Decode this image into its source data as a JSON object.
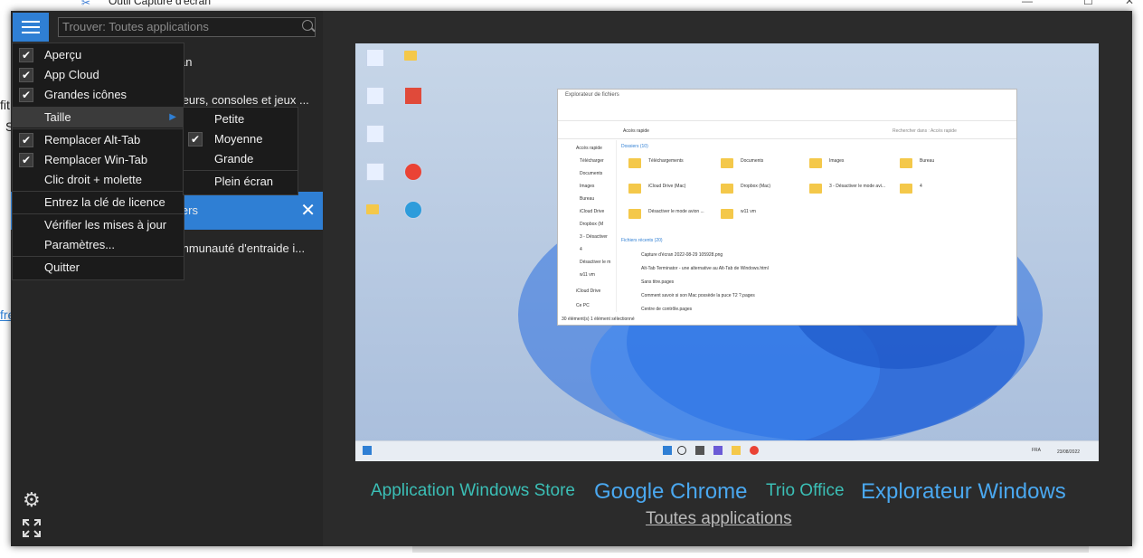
{
  "background_app": {
    "title": "Outil Capture d'écran",
    "left_fragments": [
      "fit",
      "S",
      "fre"
    ]
  },
  "search": {
    "placeholder": "Trouver: Toutes applications"
  },
  "app_list": [
    {
      "label": "an"
    },
    {
      "label": "teurs, consoles et jeux ..."
    },
    {
      "label": "iers"
    },
    {
      "label": "mmunauté d'entraide i..."
    }
  ],
  "menu": {
    "items": [
      {
        "label": "Aperçu",
        "checked": true
      },
      {
        "label": "App Cloud",
        "checked": true
      },
      {
        "label": "Grandes icônes",
        "checked": true
      },
      {
        "label": "Taille",
        "has_submenu": true
      },
      {
        "label": "Remplacer Alt-Tab",
        "checked": true
      },
      {
        "label": "Remplacer Win-Tab",
        "checked": true
      },
      {
        "label": "Clic droit + molette",
        "checked": false
      },
      {
        "label": "Entrez la clé de licence"
      },
      {
        "label": "Vérifier les mises à jour"
      },
      {
        "label": "Paramètres..."
      },
      {
        "label": "Quitter"
      }
    ],
    "size_submenu": [
      {
        "label": "Petite",
        "checked": false
      },
      {
        "label": "Moyenne",
        "checked": true
      },
      {
        "label": "Grande",
        "checked": false
      },
      {
        "label": "Plein écran",
        "checked": false
      }
    ]
  },
  "preview": {
    "explorer_title": "Explorateur de fichiers",
    "address": "Accès rapide",
    "search_placeholder": "Rechercher dans : Accès rapide",
    "folders_header": "Dossiers (10)",
    "recent_header": "Fichiers récents (20)",
    "status": "30 élément(s)   1 élément sélectionné",
    "sidebar": [
      "Accès rapide",
      "Télécharger",
      "Documents",
      "Images",
      "Bureau",
      "iCloud Drive",
      "Dropbox (M",
      "3 - Désactiver",
      "4",
      "Désactiver le m",
      "w11 vm",
      "iCloud Drive",
      "Ce PC"
    ],
    "folders": [
      "Téléchargements",
      "Documents",
      "Images",
      "Bureau",
      "iCloud Drive (Mac)",
      "Dropbox (Mac)",
      "3 - Désactiver le mode avi...",
      "4",
      "Désactiver le mode avion ...",
      "w11 vm"
    ],
    "recent_files": [
      "Capture d'écran 2022-08-29 105928.png",
      "Alt-Tab Terminator - une alternative au Alt-Tab de Windows.html",
      "Sans titre.pages",
      "Comment savoir si son Mac possède la puce T2 ?.pages",
      "Centre de contrôle.pages"
    ],
    "taskbar_time": "23/08/2022",
    "taskbar_lang": "FRA"
  },
  "app_links": {
    "store": "Application Windows Store",
    "chrome": "Google Chrome",
    "office": "Trio Office",
    "explorer": "Explorateur Windows",
    "all": "Toutes applications"
  },
  "colors": {
    "accent": "#2f7fd4",
    "teal_link": "#3bbfb6",
    "blue_link": "#4aa8f0",
    "panel_bg": "#2b2b2b",
    "menu_bg": "#1b1b1b"
  }
}
